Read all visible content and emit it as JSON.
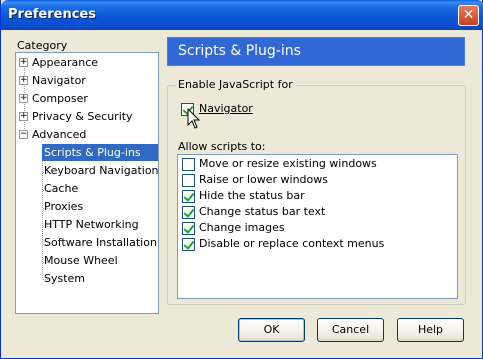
{
  "window": {
    "title": "Preferences",
    "close_glyph": "✕"
  },
  "category": {
    "label": "Category",
    "items": [
      {
        "label": "Appearance",
        "expander": "+"
      },
      {
        "label": "Navigator",
        "expander": "+"
      },
      {
        "label": "Composer",
        "expander": "+"
      },
      {
        "label": "Privacy & Security",
        "expander": "+"
      },
      {
        "label": "Advanced",
        "expander": "−"
      },
      {
        "label": "Scripts & Plug-ins",
        "selected": true
      },
      {
        "label": "Keyboard Navigation"
      },
      {
        "label": "Cache"
      },
      {
        "label": "Proxies"
      },
      {
        "label": "HTTP Networking"
      },
      {
        "label": "Software Installation"
      },
      {
        "label": "Mouse Wheel"
      },
      {
        "label": "System"
      }
    ]
  },
  "panel": {
    "title": "Scripts & Plug-ins",
    "enable_js": {
      "group_label": "Enable JavaScript for",
      "navigator": {
        "label": "Navigator",
        "checked": true
      }
    },
    "allow_label": "Allow scripts to:",
    "allow_items": [
      {
        "label": "Move or resize existing windows",
        "checked": false
      },
      {
        "label": "Raise or lower windows",
        "checked": false
      },
      {
        "label": "Hide the status bar",
        "checked": true
      },
      {
        "label": "Change status bar text",
        "checked": true
      },
      {
        "label": "Change images",
        "checked": true
      },
      {
        "label": "Disable or replace context menus",
        "checked": true
      }
    ]
  },
  "buttons": {
    "ok": "OK",
    "cancel": "Cancel",
    "help": "Help"
  },
  "colors": {
    "selection": "#316ac5",
    "header": "#3168d5",
    "titlebar": "#0a55d6",
    "check": "#21a121"
  }
}
